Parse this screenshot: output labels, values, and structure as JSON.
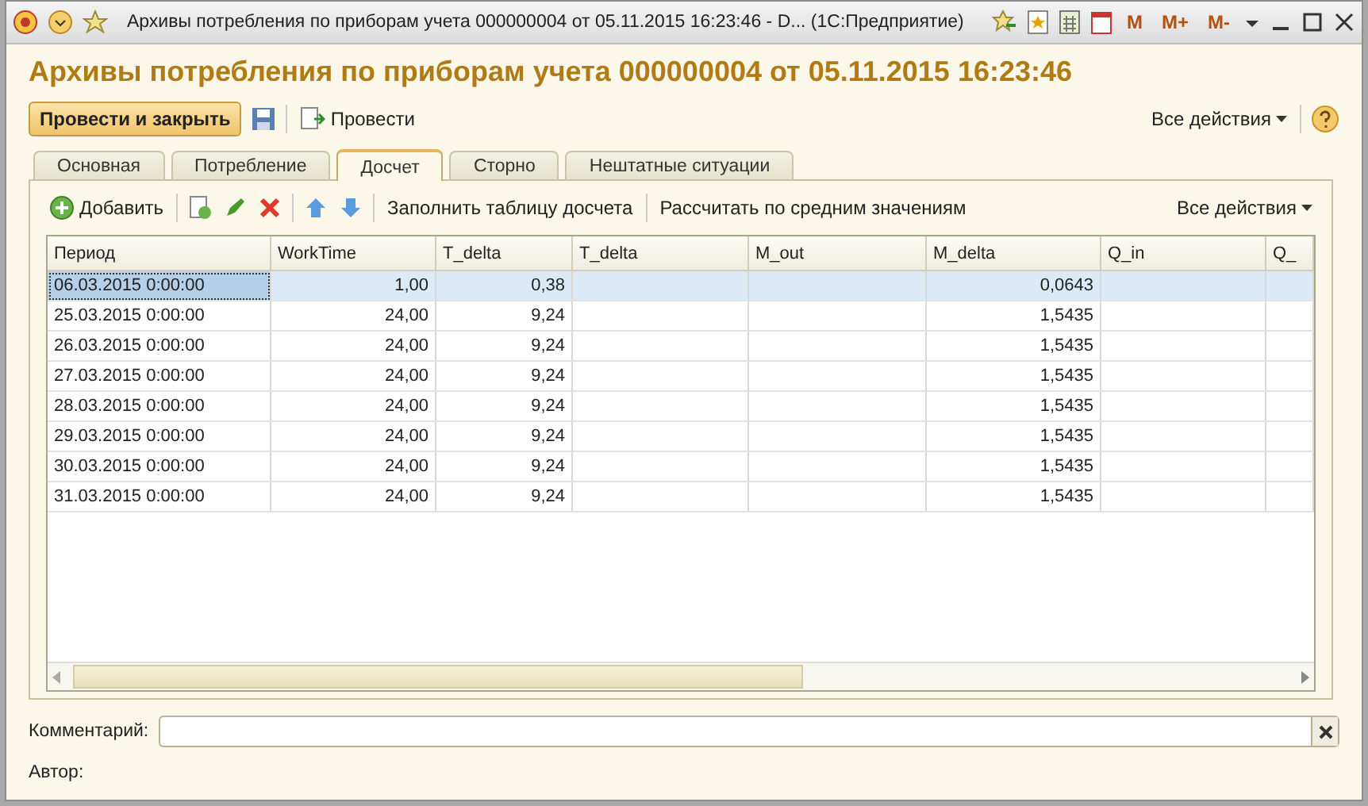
{
  "window": {
    "title": "Архивы потребления по приборам учета 000000004 от 05.11.2015 16:23:46 - D...  (1С:Предприятие)",
    "toolbar": [
      "M",
      "M+",
      "M-"
    ]
  },
  "heading": "Архивы потребления по приборам учета 000000004 от 05.11.2015 16:23:46",
  "commands": {
    "primary": "Провести и закрыть",
    "post": "Провести",
    "all_actions": "Все действия"
  },
  "tabs": [
    {
      "label": "Основная",
      "selected": false
    },
    {
      "label": "Потребление",
      "selected": false
    },
    {
      "label": "Досчет",
      "selected": true
    },
    {
      "label": "Сторно",
      "selected": false
    },
    {
      "label": "Нештатные ситуации",
      "selected": false
    }
  ],
  "table_toolbar": {
    "add": "Добавить",
    "fill": "Заполнить таблицу досчета",
    "calc": "Рассчитать по средним значениям",
    "all_actions": "Все действия"
  },
  "table": {
    "columns": [
      "Период",
      "WorkTime",
      "T_delta",
      "T_delta",
      "M_out",
      "M_delta",
      "Q_in",
      "Q_"
    ],
    "rows": [
      {
        "selected": true,
        "cells": [
          "06.03.2015 0:00:00",
          "1,00",
          "0,38",
          "",
          "",
          "0,0643",
          "",
          ""
        ]
      },
      {
        "selected": false,
        "cells": [
          "25.03.2015 0:00:00",
          "24,00",
          "9,24",
          "",
          "",
          "1,5435",
          "",
          ""
        ]
      },
      {
        "selected": false,
        "cells": [
          "26.03.2015 0:00:00",
          "24,00",
          "9,24",
          "",
          "",
          "1,5435",
          "",
          ""
        ]
      },
      {
        "selected": false,
        "cells": [
          "27.03.2015 0:00:00",
          "24,00",
          "9,24",
          "",
          "",
          "1,5435",
          "",
          ""
        ]
      },
      {
        "selected": false,
        "cells": [
          "28.03.2015 0:00:00",
          "24,00",
          "9,24",
          "",
          "",
          "1,5435",
          "",
          ""
        ]
      },
      {
        "selected": false,
        "cells": [
          "29.03.2015 0:00:00",
          "24,00",
          "9,24",
          "",
          "",
          "1,5435",
          "",
          ""
        ]
      },
      {
        "selected": false,
        "cells": [
          "30.03.2015 0:00:00",
          "24,00",
          "9,24",
          "",
          "",
          "1,5435",
          "",
          ""
        ]
      },
      {
        "selected": false,
        "cells": [
          "31.03.2015 0:00:00",
          "24,00",
          "9,24",
          "",
          "",
          "1,5435",
          "",
          ""
        ]
      }
    ]
  },
  "comment": {
    "label": "Комментарий:"
  },
  "author": {
    "label": "Автор:"
  }
}
